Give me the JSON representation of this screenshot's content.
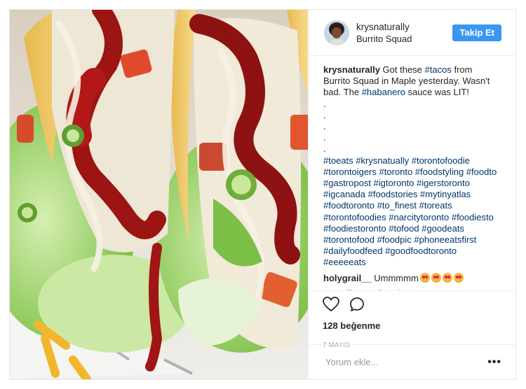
{
  "post": {
    "username": "krysnaturally",
    "location": "Burrito Squad",
    "follow_label": "Takip Et",
    "caption_user": "krysnaturally",
    "caption_parts": [
      {
        "t": " Got these ",
        "h": false
      },
      {
        "t": "#tacos",
        "h": true
      },
      {
        "t": " from Burrito Squad in Maple yesterday. Wasn't bad. The ",
        "h": false
      },
      {
        "t": "#habanero",
        "h": true
      },
      {
        "t": " sauce was LIT!",
        "h": false
      }
    ],
    "dots": [
      ".",
      ".",
      ".",
      ".",
      "."
    ],
    "hashtags": "#toeats #krysnatually #torontofoodie #torontoigers #toronto #foodstyling #foodto #gastropost #igtoronto #igerstoronto #igcanada #foodstories #mytinyatlas #foodtoronto #to_finest #toreats #torontofoodies #narcitytoronto #foodiesto #foodiestoronto #tofood #goodeats #torontofood #foodpic #phoneeatsfirst #dailyfoodfeed #goodfoodtoronto #eeeeeats",
    "comments": [
      {
        "user": "holygrail__",
        "text": " Ummmmm",
        "emoji_count": 4
      },
      {
        "user": "macallanspub",
        "text": " Enjoy!",
        "emoji_count": 0
      }
    ],
    "likes": "128 beğenme",
    "date": "7 MAYIS",
    "comment_placeholder": "Yorum ekle...",
    "more_label": "•••"
  },
  "icons": {
    "like": "heart-icon",
    "comment": "speech-bubble-icon",
    "more": "more-options-icon"
  },
  "colors": {
    "follow_button": "#3897f0",
    "hashtag": "#003569",
    "muted": "#999999"
  }
}
